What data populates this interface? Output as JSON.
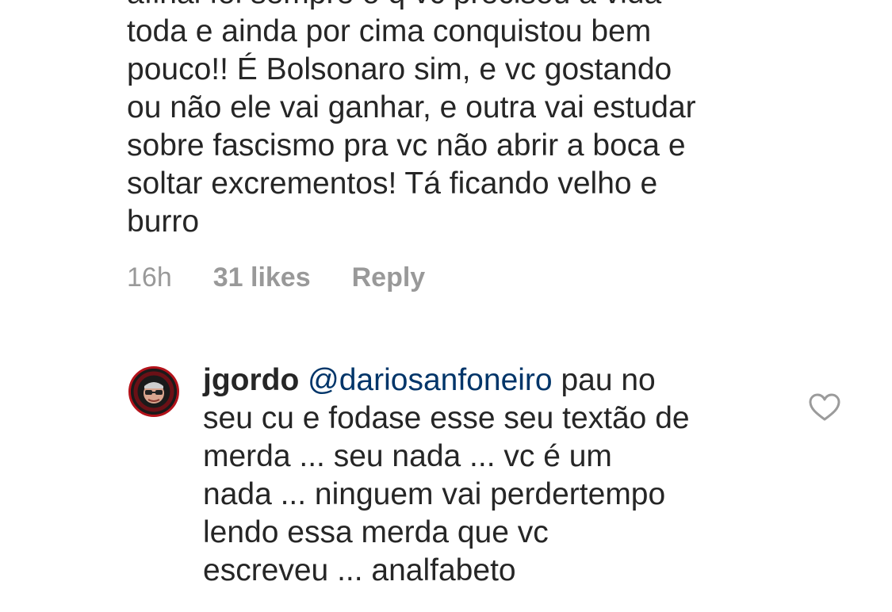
{
  "comment_top": {
    "lines": [
      "afinal foi sempre o q vc precisou a vida",
      "toda e ainda por cima conquistou bem",
      "pouco!! É Bolsonaro sim, e vc gostando",
      "ou não ele vai ganhar, e outra vai estudar",
      "sobre fascismo pra vc não abrir a boca e",
      "soltar excrementos! Tá ficando velho e",
      "burro"
    ],
    "time": "16h",
    "likes": "31 likes",
    "reply": "Reply"
  },
  "comment_reply": {
    "username": "jgordo",
    "mention": "@dariosanfoneiro",
    "first_line_rest": " pau no",
    "lines": [
      "seu cu e fodase esse seu textão de",
      "merda ... seu nada ... vc é um",
      "nada ... ninguem vai perdertempo",
      "lendo essa merda que vc",
      "escreveu ... analfabeto"
    ],
    "avatar_icon": "profile-avatar",
    "like_icon": "heart-outline-icon"
  },
  "colors": {
    "text": "#262626",
    "meta": "#999999",
    "mention": "#003569",
    "avatar_ring": "#b3121a"
  }
}
